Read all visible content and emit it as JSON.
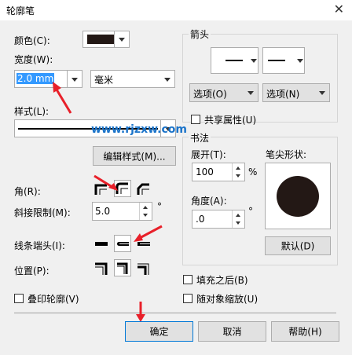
{
  "window": {
    "title": "轮廓笔",
    "close": "✕"
  },
  "left": {
    "color_label": "颜色(C):",
    "color_value": "#231815",
    "width_label": "宽度(W):",
    "width_value": "2.0 mm",
    "unit_value": "毫米",
    "style_label": "样式(L):",
    "edit_style_button": "编辑样式(M)...",
    "corner_label": "角(R):",
    "miter_label": "斜接限制(M):",
    "miter_value": "5.0",
    "degree": "°",
    "line_cap_label": "线条端头(I):",
    "position_label": "位置(P):",
    "overprint_label": "叠印轮廓(V)"
  },
  "watermark": "www.rjzxw.com",
  "arrows": {
    "group_label": "箭头",
    "options_left": "选项(O)",
    "options_right": "选项(N)",
    "share_label": "共享属性(U)"
  },
  "calligraphy": {
    "group_label": "书法",
    "stretch_label": "展开(T):",
    "stretch_value": "100",
    "percent": "%",
    "angle_label": "角度(A):",
    "angle_value": ".0",
    "degree": "°",
    "nib_label": "笔尖形状:",
    "default_button": "默认(D)"
  },
  "options": {
    "fill_behind_label": "填充之后(B)",
    "scale_with_image_label": "随对象缩放(U)"
  },
  "footer": {
    "ok": "确定",
    "cancel": "取消",
    "help": "帮助(H)"
  },
  "colors": {
    "annotation_red": "#e8202a",
    "watermark_blue": "#1a73c9",
    "nib_color": "#231815",
    "selection_blue": "#3399ff"
  }
}
